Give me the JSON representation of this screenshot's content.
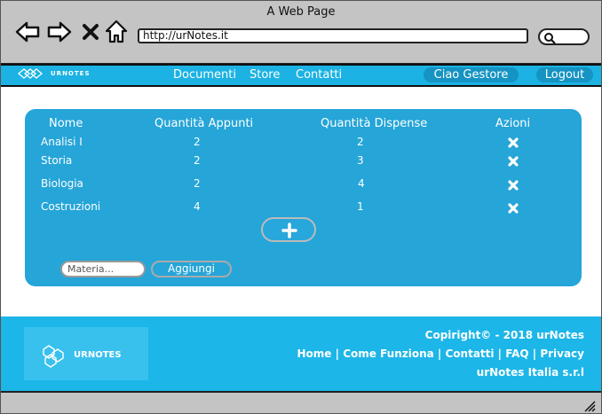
{
  "window": {
    "title": "A Web Page"
  },
  "browser": {
    "url": "http://urNotes.it"
  },
  "navbar": {
    "brand": "URNOTES",
    "links": [
      "Documenti",
      "Store",
      "Contatti"
    ],
    "greeting": "Ciao Gestore",
    "logout": "Logout"
  },
  "table": {
    "headers": [
      "Nome",
      "Quantità Appunti",
      "Quantità Dispense",
      "Azioni"
    ],
    "rows": [
      {
        "nome": "Analisi I",
        "appunti": "2",
        "dispense": "2"
      },
      {
        "nome": "Storia",
        "appunti": "2",
        "dispense": "3"
      },
      {
        "nome": "Biologia",
        "appunti": "2",
        "dispense": "4"
      },
      {
        "nome": "Costruzioni",
        "appunti": "4",
        "dispense": "1"
      }
    ]
  },
  "form": {
    "materia_placeholder": "Materia...",
    "aggiungi_label": "Aggiungi"
  },
  "footer": {
    "brand": "URNOTES",
    "copyright": "Copiright© - 2018 urNotes",
    "links": [
      "Home",
      "Come Funziona",
      "Contatti",
      "FAQ",
      "Privacy"
    ],
    "separator": " | ",
    "company": "urNotes Italia s.r.l"
  },
  "colors": {
    "accent": "#1cb2e3",
    "panel": "#25a5d8",
    "chrome": "#c4c4c4"
  }
}
